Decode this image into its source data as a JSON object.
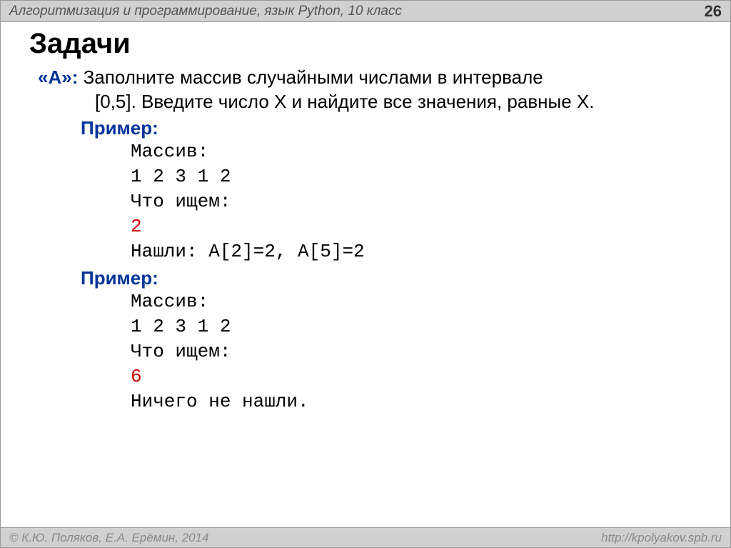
{
  "header": {
    "title": "Алгоритмизация и программирование, язык Python, 10 класс",
    "page_number": "26"
  },
  "main": {
    "title": "Задачи",
    "task_label": "«A»:",
    "task_line1": " Заполните массив случайными числами в интервале",
    "task_line2": "[0,5]. Введите число X и найдите все значения, равные X.",
    "example1": {
      "label": "Пример:",
      "array_label": "Массив:",
      "array_values": "1 2 3 1 2",
      "search_label": "Что ищем:",
      "search_value": "2",
      "result": "Нашли: A[2]=2, A[5]=2"
    },
    "example2": {
      "label": "Пример:",
      "array_label": "Массив:",
      "array_values": "1 2 3 1 2",
      "search_label": "Что ищем:",
      "search_value": "6",
      "result": "Ничего не нашли."
    }
  },
  "footer": {
    "copyright": "© К.Ю. Поляков, Е.А. Ерёмин, 2014",
    "url": "http://kpolyakov.spb.ru"
  }
}
